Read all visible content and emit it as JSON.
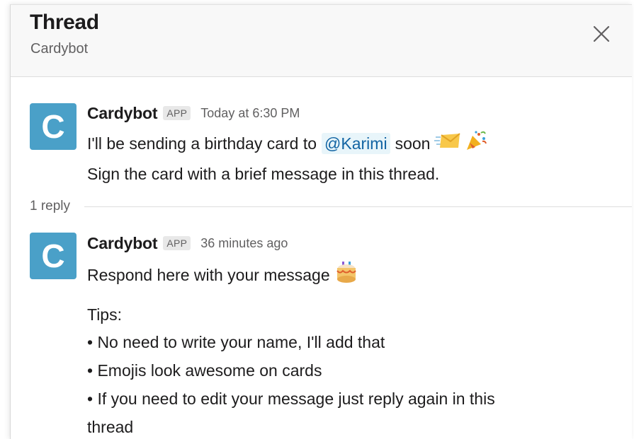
{
  "header": {
    "title": "Thread",
    "subtitle": "Cardybot",
    "close_icon": "close-icon"
  },
  "thread": {
    "parent": {
      "avatar_letter": "C",
      "sender": "Cardybot",
      "badge": "APP",
      "timestamp": "Today at 6:30 PM",
      "line1_before": "I'll be sending a birthday card to",
      "mention": "@Karimi",
      "line1_after": "soon",
      "line1_emojis": [
        "envelope-icon",
        "party-popper-icon"
      ],
      "line2": "Sign the card with a brief message in this thread."
    },
    "reply_count": "1 reply",
    "reply": {
      "avatar_letter": "C",
      "sender": "Cardybot",
      "badge": "APP",
      "timestamp": "36 minutes ago",
      "line1": "Respond here with your message",
      "line1_emoji": "birthday-cake-icon",
      "tips_heading": "Tips:",
      "tips": [
        "• No need to write your name, I'll add that",
        "• Emojis look awesome on cards",
        "• If you need to edit your message just reply again in this",
        "thread"
      ]
    }
  },
  "colors": {
    "avatar": "#4aa0c8",
    "mention_bg": "#e8f5fa",
    "mention_text": "#1264a3",
    "header_bg": "#f8f8f8"
  }
}
